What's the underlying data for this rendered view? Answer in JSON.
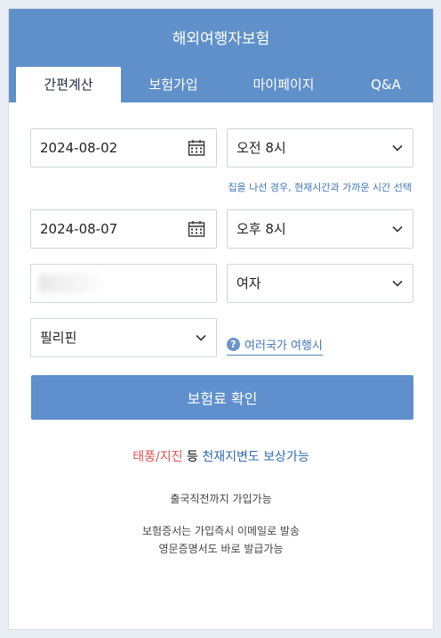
{
  "header": {
    "title": "해외여행자보험"
  },
  "tabs": [
    {
      "label": "간편계산"
    },
    {
      "label": "보험가입"
    },
    {
      "label": "마이페이지"
    },
    {
      "label": "Q&A"
    }
  ],
  "form": {
    "start_date": "2024-08-02",
    "start_time": "오전 8시",
    "time_hint": "집을 나선 경우, 현재시간과 가까운 시간 선택",
    "end_date": "2024-08-07",
    "end_time": "오후 8시",
    "gender": "여자",
    "country": "필리핀",
    "multi_country_link": "여러국가 여행시",
    "help_icon_glyph": "?"
  },
  "confirm_button": "보험료 확인",
  "promo": {
    "red": "태풍/지진",
    "mid": " 등 ",
    "blue": "천재지변도 보상가능"
  },
  "notes": {
    "line1": "출국직전까지 가입가능",
    "line2": "보험증서는 가입즉시 이메일로 발송",
    "line3": "영문증명서도 바로 발급가능"
  },
  "colors": {
    "header_bg": "#6090c9",
    "button_bg": "#5f8fcc",
    "link": "#3f77b8",
    "promo_red": "#e05050",
    "promo_blue": "#2f6db2"
  }
}
